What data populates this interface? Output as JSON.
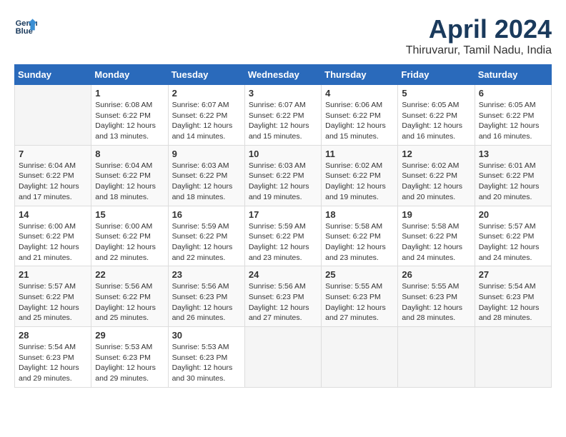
{
  "header": {
    "logo_line1": "General",
    "logo_line2": "Blue",
    "month_year": "April 2024",
    "location": "Thiruvarur, Tamil Nadu, India"
  },
  "weekdays": [
    "Sunday",
    "Monday",
    "Tuesday",
    "Wednesday",
    "Thursday",
    "Friday",
    "Saturday"
  ],
  "weeks": [
    [
      {
        "day": "",
        "info": ""
      },
      {
        "day": "1",
        "info": "Sunrise: 6:08 AM\nSunset: 6:22 PM\nDaylight: 12 hours\nand 13 minutes."
      },
      {
        "day": "2",
        "info": "Sunrise: 6:07 AM\nSunset: 6:22 PM\nDaylight: 12 hours\nand 14 minutes."
      },
      {
        "day": "3",
        "info": "Sunrise: 6:07 AM\nSunset: 6:22 PM\nDaylight: 12 hours\nand 15 minutes."
      },
      {
        "day": "4",
        "info": "Sunrise: 6:06 AM\nSunset: 6:22 PM\nDaylight: 12 hours\nand 15 minutes."
      },
      {
        "day": "5",
        "info": "Sunrise: 6:05 AM\nSunset: 6:22 PM\nDaylight: 12 hours\nand 16 minutes."
      },
      {
        "day": "6",
        "info": "Sunrise: 6:05 AM\nSunset: 6:22 PM\nDaylight: 12 hours\nand 16 minutes."
      }
    ],
    [
      {
        "day": "7",
        "info": "Sunrise: 6:04 AM\nSunset: 6:22 PM\nDaylight: 12 hours\nand 17 minutes."
      },
      {
        "day": "8",
        "info": "Sunrise: 6:04 AM\nSunset: 6:22 PM\nDaylight: 12 hours\nand 18 minutes."
      },
      {
        "day": "9",
        "info": "Sunrise: 6:03 AM\nSunset: 6:22 PM\nDaylight: 12 hours\nand 18 minutes."
      },
      {
        "day": "10",
        "info": "Sunrise: 6:03 AM\nSunset: 6:22 PM\nDaylight: 12 hours\nand 19 minutes."
      },
      {
        "day": "11",
        "info": "Sunrise: 6:02 AM\nSunset: 6:22 PM\nDaylight: 12 hours\nand 19 minutes."
      },
      {
        "day": "12",
        "info": "Sunrise: 6:02 AM\nSunset: 6:22 PM\nDaylight: 12 hours\nand 20 minutes."
      },
      {
        "day": "13",
        "info": "Sunrise: 6:01 AM\nSunset: 6:22 PM\nDaylight: 12 hours\nand 20 minutes."
      }
    ],
    [
      {
        "day": "14",
        "info": "Sunrise: 6:00 AM\nSunset: 6:22 PM\nDaylight: 12 hours\nand 21 minutes."
      },
      {
        "day": "15",
        "info": "Sunrise: 6:00 AM\nSunset: 6:22 PM\nDaylight: 12 hours\nand 22 minutes."
      },
      {
        "day": "16",
        "info": "Sunrise: 5:59 AM\nSunset: 6:22 PM\nDaylight: 12 hours\nand 22 minutes."
      },
      {
        "day": "17",
        "info": "Sunrise: 5:59 AM\nSunset: 6:22 PM\nDaylight: 12 hours\nand 23 minutes."
      },
      {
        "day": "18",
        "info": "Sunrise: 5:58 AM\nSunset: 6:22 PM\nDaylight: 12 hours\nand 23 minutes."
      },
      {
        "day": "19",
        "info": "Sunrise: 5:58 AM\nSunset: 6:22 PM\nDaylight: 12 hours\nand 24 minutes."
      },
      {
        "day": "20",
        "info": "Sunrise: 5:57 AM\nSunset: 6:22 PM\nDaylight: 12 hours\nand 24 minutes."
      }
    ],
    [
      {
        "day": "21",
        "info": "Sunrise: 5:57 AM\nSunset: 6:22 PM\nDaylight: 12 hours\nand 25 minutes."
      },
      {
        "day": "22",
        "info": "Sunrise: 5:56 AM\nSunset: 6:22 PM\nDaylight: 12 hours\nand 25 minutes."
      },
      {
        "day": "23",
        "info": "Sunrise: 5:56 AM\nSunset: 6:23 PM\nDaylight: 12 hours\nand 26 minutes."
      },
      {
        "day": "24",
        "info": "Sunrise: 5:56 AM\nSunset: 6:23 PM\nDaylight: 12 hours\nand 27 minutes."
      },
      {
        "day": "25",
        "info": "Sunrise: 5:55 AM\nSunset: 6:23 PM\nDaylight: 12 hours\nand 27 minutes."
      },
      {
        "day": "26",
        "info": "Sunrise: 5:55 AM\nSunset: 6:23 PM\nDaylight: 12 hours\nand 28 minutes."
      },
      {
        "day": "27",
        "info": "Sunrise: 5:54 AM\nSunset: 6:23 PM\nDaylight: 12 hours\nand 28 minutes."
      }
    ],
    [
      {
        "day": "28",
        "info": "Sunrise: 5:54 AM\nSunset: 6:23 PM\nDaylight: 12 hours\nand 29 minutes."
      },
      {
        "day": "29",
        "info": "Sunrise: 5:53 AM\nSunset: 6:23 PM\nDaylight: 12 hours\nand 29 minutes."
      },
      {
        "day": "30",
        "info": "Sunrise: 5:53 AM\nSunset: 6:23 PM\nDaylight: 12 hours\nand 30 minutes."
      },
      {
        "day": "",
        "info": ""
      },
      {
        "day": "",
        "info": ""
      },
      {
        "day": "",
        "info": ""
      },
      {
        "day": "",
        "info": ""
      }
    ]
  ]
}
